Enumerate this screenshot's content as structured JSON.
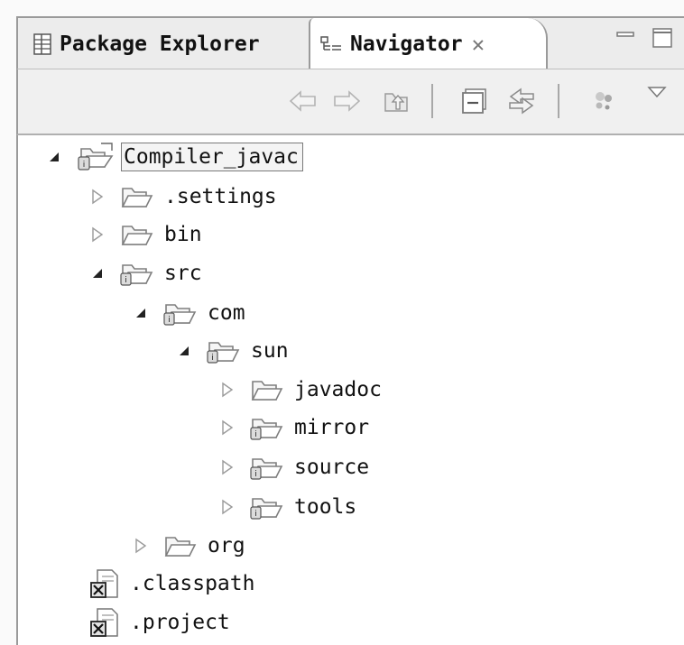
{
  "tabs": {
    "package_explorer": "Package Explorer",
    "navigator": "Navigator",
    "navigator_close_glyph": "✕"
  },
  "icons": {
    "tab_package": "package-explorer-icon",
    "tab_navigator": "navigator-icon",
    "minimize": "minimize-icon",
    "maximize": "maximize-icon",
    "back": "back-arrow-icon",
    "forward": "forward-arrow-icon",
    "up": "go-up-icon",
    "collapse_all": "collapse-all-icon",
    "link_editor": "link-with-editor-icon",
    "filters": "filters-icon",
    "view_menu": "view-menu-icon"
  },
  "tree": [
    {
      "label": "Compiler_javac",
      "kind": "project",
      "expanded": true
    },
    {
      "label": ".settings",
      "kind": "folder",
      "expanded": false
    },
    {
      "label": "bin",
      "kind": "folder",
      "expanded": false
    },
    {
      "label": "src",
      "kind": "package-folder",
      "expanded": true
    },
    {
      "label": "com",
      "kind": "package-folder",
      "expanded": true
    },
    {
      "label": "sun",
      "kind": "package-folder",
      "expanded": true
    },
    {
      "label": "javadoc",
      "kind": "folder",
      "expanded": false
    },
    {
      "label": "mirror",
      "kind": "package-folder",
      "expanded": false
    },
    {
      "label": "source",
      "kind": "package-folder",
      "expanded": false
    },
    {
      "label": "tools",
      "kind": "package-folder",
      "expanded": false
    },
    {
      "label": "org",
      "kind": "folder",
      "expanded": false
    },
    {
      "label": ".classpath",
      "kind": "file"
    },
    {
      "label": ".project",
      "kind": "file"
    }
  ]
}
